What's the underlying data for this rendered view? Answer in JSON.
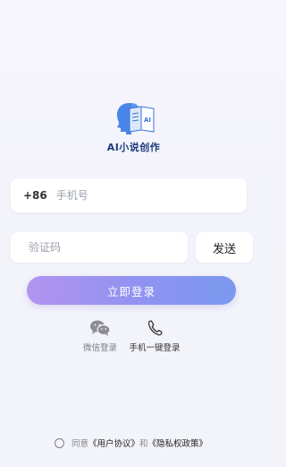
{
  "app": {
    "title": "AI小说创作",
    "logo_badge": "AI"
  },
  "login_form": {
    "country_code": "+86",
    "phone_placeholder": "手机号",
    "code_placeholder": "验证码",
    "send_label": "发送",
    "login_label": "立即登录"
  },
  "alt_login": {
    "wechat_label": "微信登录",
    "one_key_label": "手机一键登录",
    "wechat_icon": "wechat-icon",
    "one_key_icon": "phone-icon"
  },
  "agreement": {
    "prefix": "同意",
    "user_agreement": "《用户协议》",
    "conjunction": "和",
    "privacy_policy": "《隐私权政策》"
  },
  "colors": {
    "brand_blue": "#3b73d9",
    "brand_navy": "#1f3a7a",
    "button_gradient_start": "#b293f0",
    "button_gradient_end": "#7a99ee",
    "background": "#f5f4fb"
  }
}
